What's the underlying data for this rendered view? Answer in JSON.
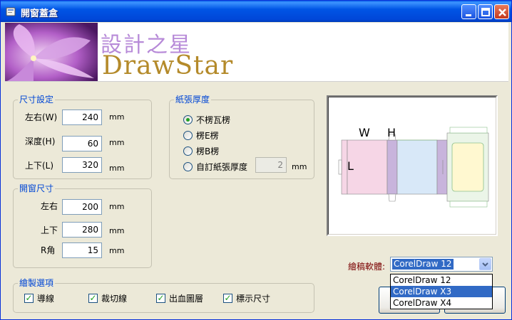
{
  "window": {
    "title": "開窗蓋盒"
  },
  "banner": {
    "title_cn": "設計之星",
    "title_en": "DrawStar"
  },
  "size_group": {
    "label": "尺寸設定",
    "fields": [
      {
        "label": "左右(W)",
        "value": "240",
        "unit": "mm"
      },
      {
        "label": "深度(H)",
        "value": "60",
        "unit": "mm"
      },
      {
        "label": "上下(L)",
        "value": "320",
        "unit": "mm"
      }
    ]
  },
  "window_group": {
    "label": "開窗尺寸",
    "fields": [
      {
        "label": "左右",
        "value": "200",
        "unit": "mm"
      },
      {
        "label": "上下",
        "value": "280",
        "unit": "mm"
      },
      {
        "label": "R角",
        "value": "15",
        "unit": "mm"
      }
    ]
  },
  "paper_group": {
    "label": "紙張厚度",
    "options": [
      {
        "label": "不楞瓦楞",
        "selected": true
      },
      {
        "label": "楞E楞",
        "selected": false
      },
      {
        "label": "楞B楞",
        "selected": false
      },
      {
        "label": "自訂紙張厚度",
        "selected": false
      }
    ],
    "custom_value": "2",
    "custom_unit": "mm"
  },
  "draw_group": {
    "label": "繪製選項",
    "options": [
      {
        "label": "導線",
        "checked": true
      },
      {
        "label": "裁切線",
        "checked": true
      },
      {
        "label": "出血圖層",
        "checked": true
      },
      {
        "label": "標示尺寸",
        "checked": true
      }
    ]
  },
  "preview": {
    "w_label": "W",
    "h_label": "H",
    "l_label": "L"
  },
  "software": {
    "label": "繪稿軟體:",
    "selected": "CorelDraw 12",
    "options": [
      "CorelDraw 12",
      "CorelDraw X3",
      "CorelDraw X4"
    ],
    "highlighted_index": 1
  },
  "colors": {
    "title_bar": "#0055e5",
    "group_label": "#0046d5",
    "selection": "#316ac5",
    "preview_pink": "#f6d6e6",
    "preview_blue": "#d8e8f8",
    "preview_purple": "#c8b4dc",
    "preview_yellow": "#fff8d0"
  }
}
